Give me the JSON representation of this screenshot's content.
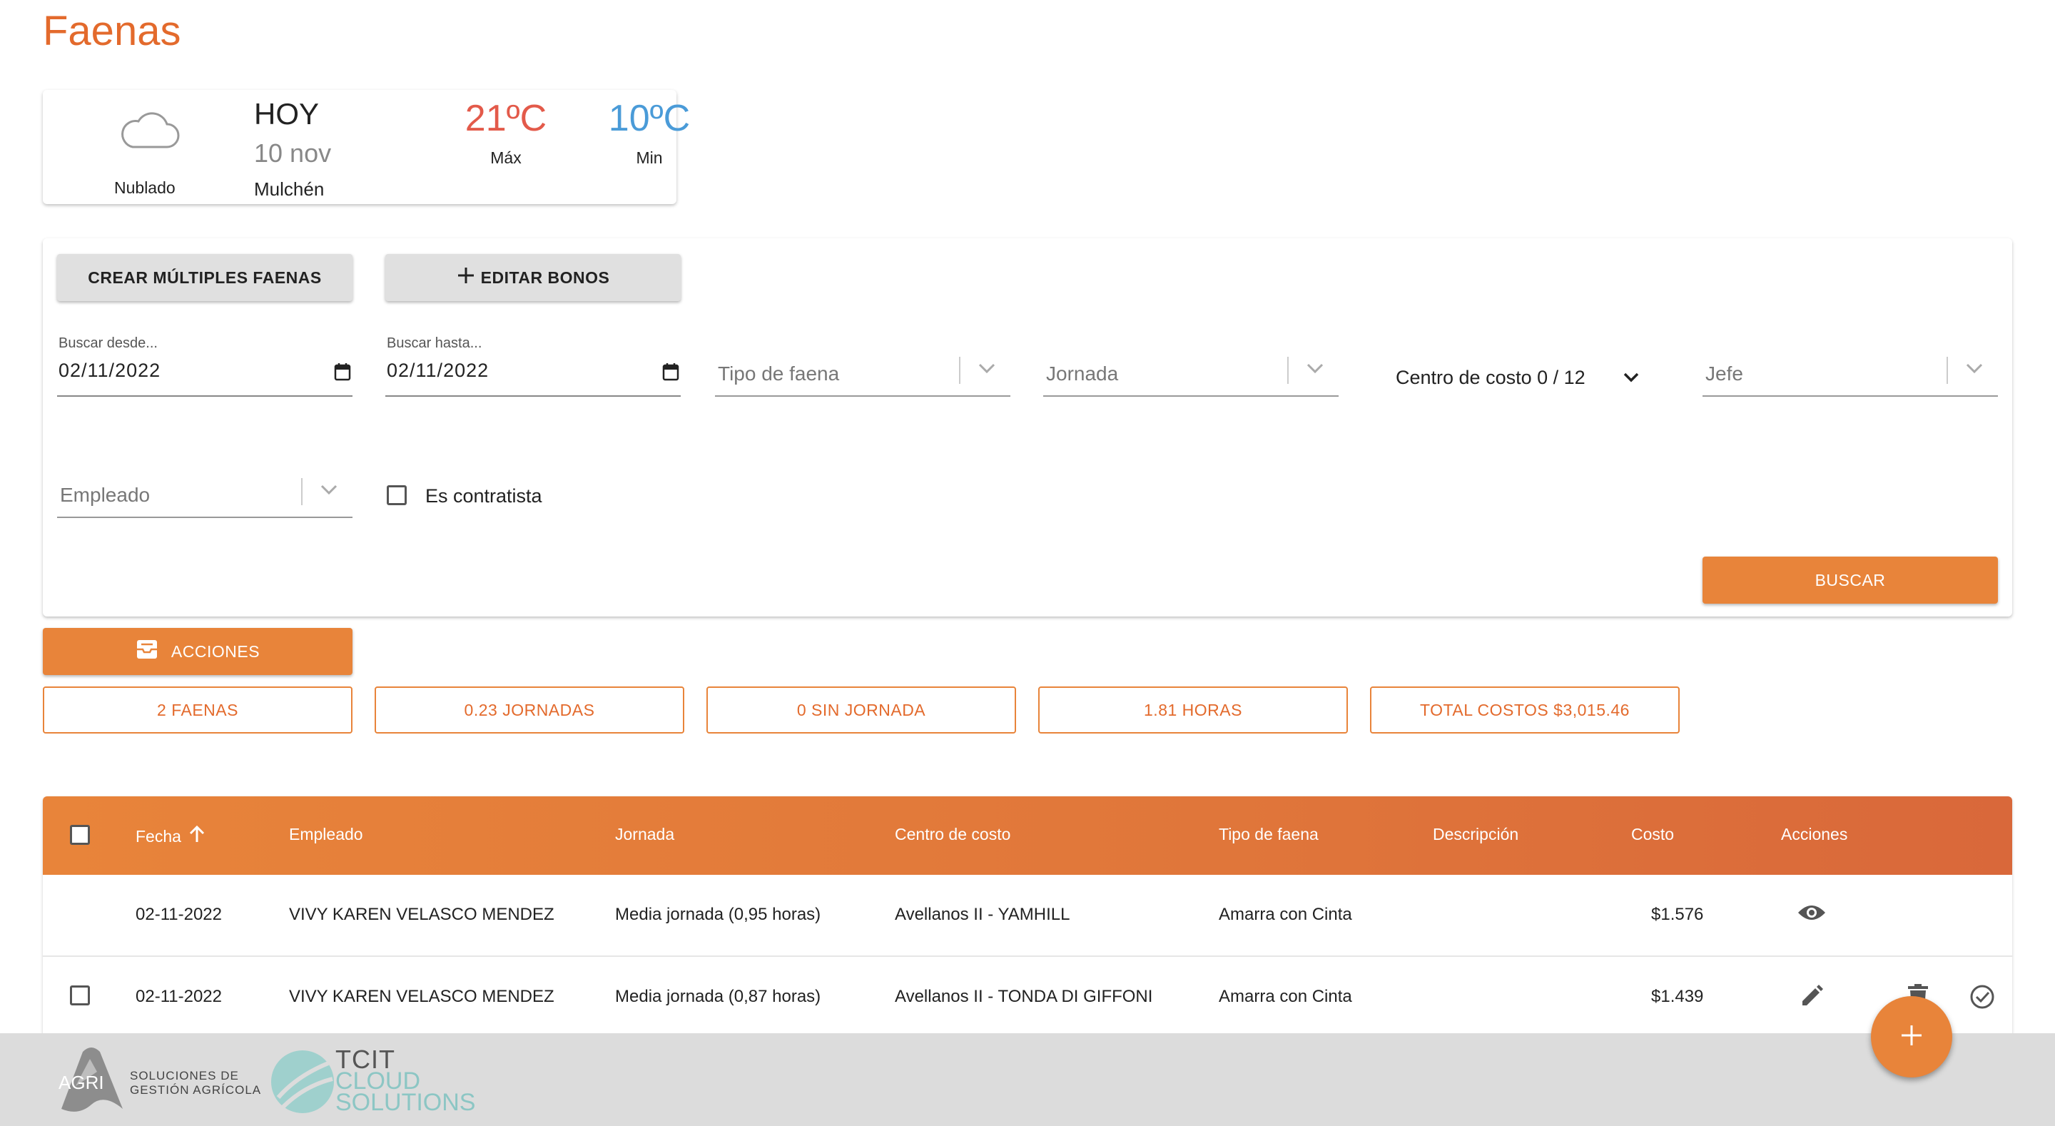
{
  "page": {
    "title": "Faenas"
  },
  "weather": {
    "icon": "cloud-icon",
    "condition": "Nublado",
    "day_label": "HOY",
    "date": "10 nov",
    "city": "Mulchén",
    "max_temp": "21ºC",
    "max_label": "Máx",
    "min_temp": "10ºC",
    "min_label": "Min",
    "max_color": "#e35a4a",
    "min_color": "#4a9bd8"
  },
  "filters": {
    "create_multiple_label": "CREAR MÚLTIPLES FAENAS",
    "edit_bonus_label": "EDITAR BONOS",
    "date_from": {
      "label": "Buscar desde...",
      "value": "02/11/2022"
    },
    "date_to": {
      "label": "Buscar hasta...",
      "value": "02/11/2022"
    },
    "task_type_placeholder": "Tipo de faena",
    "shift_placeholder": "Jornada",
    "cost_center_label": "Centro de costo 0 / 12",
    "boss_placeholder": "Jefe",
    "employee_placeholder": "Empleado",
    "contractor_label": "Es contratista",
    "search_label": "BUSCAR"
  },
  "actions": {
    "label": "ACCIONES"
  },
  "stats": [
    "2 FAENAS",
    "0.23 JORNADAS",
    "0 SIN JORNADA",
    "1.81 HORAS",
    "TOTAL COSTOS $3,015.46"
  ],
  "table": {
    "headers": {
      "date": "Fecha",
      "employee": "Empleado",
      "shift": "Jornada",
      "cost_center": "Centro de costo",
      "task_type": "Tipo de faena",
      "description": "Descripción",
      "cost": "Costo",
      "actions": "Acciones"
    },
    "rows": [
      {
        "date": "02-11-2022",
        "employee": "VIVY KAREN VELASCO MENDEZ",
        "shift": "Media jornada (0,95 horas)",
        "cost_center": "Avellanos II - YAMHILL",
        "task_type": "Amarra con Cinta",
        "description": "",
        "cost": "$1.576"
      },
      {
        "date": "02-11-2022",
        "employee": "VIVY KAREN VELASCO MENDEZ",
        "shift": "Media jornada (0,87 horas)",
        "cost_center": "Avellanos II - TONDA DI GIFFONI",
        "task_type": "Amarra con Cinta",
        "description": "",
        "cost": "$1.439"
      }
    ]
  },
  "footer": {
    "agri_logo": "AGRI",
    "agri_tagline_1": "SOLUCIONES DE",
    "agri_tagline_2": "GESTIÓN AGRÍCOLA",
    "tcit_1": "TCIT",
    "tcit_2": "CLOUD",
    "tcit_3": "SOLUTIONS"
  },
  "colors": {
    "accent": "#e8843a",
    "title": "#e36a2c"
  }
}
